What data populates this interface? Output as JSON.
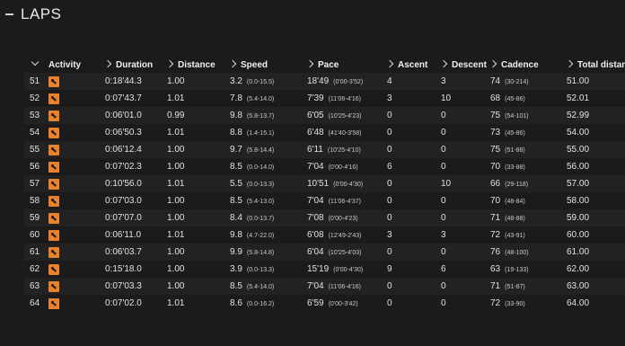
{
  "page": {
    "title": "LAPS"
  },
  "columns": [
    "Activity",
    "Duration",
    "Distance",
    "Speed",
    "Pace",
    "Ascent",
    "Descent",
    "Cadence",
    "Total distance"
  ],
  "icon": "running-icon",
  "colors": {
    "accent": "#e8822c",
    "background": "#1b1b1b"
  },
  "rows": [
    {
      "lap": "51",
      "duration": "0:18'44.3",
      "distance": "1.00",
      "speed": "3.2",
      "speed_range": "(0.0-15.5)",
      "pace": "18'49",
      "pace_range": "(0'00-3'52)",
      "ascent": "4",
      "descent": "3",
      "cadence": "74",
      "cadence_range": "(30-214)",
      "total": "51.00"
    },
    {
      "lap": "52",
      "duration": "0:07'43.7",
      "distance": "1.01",
      "speed": "7.8",
      "speed_range": "(5.4-14.0)",
      "pace": "7'39",
      "pace_range": "(11'06-4'16)",
      "ascent": "3",
      "descent": "10",
      "cadence": "68",
      "cadence_range": "(45-86)",
      "total": "52.01"
    },
    {
      "lap": "53",
      "duration": "0:06'01.0",
      "distance": "0.99",
      "speed": "9.8",
      "speed_range": "(5.8-13.7)",
      "pace": "6'05",
      "pace_range": "(10'25-4'23)",
      "ascent": "0",
      "descent": "0",
      "cadence": "75",
      "cadence_range": "(54-101)",
      "total": "52.99"
    },
    {
      "lap": "54",
      "duration": "0:06'50.3",
      "distance": "1.01",
      "speed": "8.8",
      "speed_range": "(1.4-15.1)",
      "pace": "6'48",
      "pace_range": "(41'40-3'58)",
      "ascent": "0",
      "descent": "0",
      "cadence": "73",
      "cadence_range": "(45-86)",
      "total": "54.00"
    },
    {
      "lap": "55",
      "duration": "0:06'12.4",
      "distance": "1.00",
      "speed": "9.7",
      "speed_range": "(5.8-14.4)",
      "pace": "6'11",
      "pace_range": "(10'25-4'10)",
      "ascent": "0",
      "descent": "0",
      "cadence": "75",
      "cadence_range": "(51-88)",
      "total": "55.00"
    },
    {
      "lap": "56",
      "duration": "0:07'02.3",
      "distance": "1.00",
      "speed": "8.5",
      "speed_range": "(0.0-14.0)",
      "pace": "7'04",
      "pace_range": "(0'00-4'16)",
      "ascent": "6",
      "descent": "0",
      "cadence": "70",
      "cadence_range": "(33-88)",
      "total": "56.00"
    },
    {
      "lap": "57",
      "duration": "0:10'56.0",
      "distance": "1.01",
      "speed": "5.5",
      "speed_range": "(0.0-13.3)",
      "pace": "10'51",
      "pace_range": "(0'00-4'30)",
      "ascent": "0",
      "descent": "10",
      "cadence": "66",
      "cadence_range": "(29-118)",
      "total": "57.00"
    },
    {
      "lap": "58",
      "duration": "0:07'03.0",
      "distance": "1.00",
      "speed": "8.5",
      "speed_range": "(5.4-13.0)",
      "pace": "7'04",
      "pace_range": "(11'06-4'37)",
      "ascent": "0",
      "descent": "0",
      "cadence": "70",
      "cadence_range": "(48-84)",
      "total": "58.00"
    },
    {
      "lap": "59",
      "duration": "0:07'07.0",
      "distance": "1.00",
      "speed": "8.4",
      "speed_range": "(0.0-13.7)",
      "pace": "7'08",
      "pace_range": "(0'00-4'23)",
      "ascent": "0",
      "descent": "0",
      "cadence": "71",
      "cadence_range": "(48-88)",
      "total": "59.00"
    },
    {
      "lap": "60",
      "duration": "0:06'11.0",
      "distance": "1.01",
      "speed": "9.8",
      "speed_range": "(4.7-22.0)",
      "pace": "6'08",
      "pace_range": "(12'49-2'43)",
      "ascent": "3",
      "descent": "3",
      "cadence": "72",
      "cadence_range": "(43-91)",
      "total": "60.00"
    },
    {
      "lap": "61",
      "duration": "0:06'03.7",
      "distance": "1.00",
      "speed": "9.9",
      "speed_range": "(5.8-14.8)",
      "pace": "6'04",
      "pace_range": "(10'25-4'03)",
      "ascent": "0",
      "descent": "0",
      "cadence": "76",
      "cadence_range": "(48-100)",
      "total": "61.00"
    },
    {
      "lap": "62",
      "duration": "0:15'18.0",
      "distance": "1.00",
      "speed": "3.9",
      "speed_range": "(0.0-13.3)",
      "pace": "15'19",
      "pace_range": "(0'00-4'30)",
      "ascent": "9",
      "descent": "6",
      "cadence": "63",
      "cadence_range": "(19-133)",
      "total": "62.00"
    },
    {
      "lap": "63",
      "duration": "0:07'03.3",
      "distance": "1.00",
      "speed": "8.5",
      "speed_range": "(5.4-14.0)",
      "pace": "7'04",
      "pace_range": "(11'06-4'16)",
      "ascent": "0",
      "descent": "0",
      "cadence": "71",
      "cadence_range": "(51-87)",
      "total": "63.00"
    },
    {
      "lap": "64",
      "duration": "0:07'02.0",
      "distance": "1.01",
      "speed": "8.6",
      "speed_range": "(0.0-16.2)",
      "pace": "6'59",
      "pace_range": "(0'00-3'42)",
      "ascent": "0",
      "descent": "0",
      "cadence": "72",
      "cadence_range": "(33-90)",
      "total": "64.00"
    }
  ]
}
